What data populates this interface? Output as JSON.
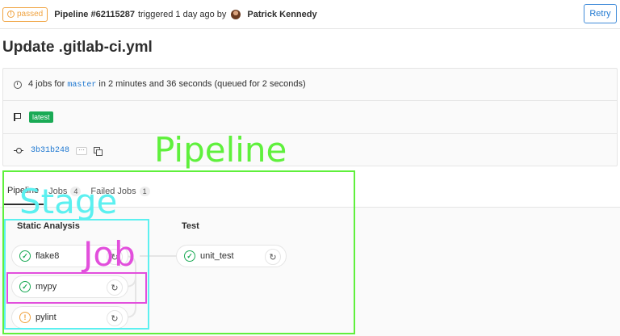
{
  "header": {
    "status_label": "passed",
    "status_icon": "warning-circle-icon",
    "pipeline_title": "Pipeline #62115287",
    "triggered_text": "triggered 1 day ago by",
    "author": "Patrick Kennedy",
    "retry_label": "Retry"
  },
  "commit": {
    "title": "Update .gitlab-ci.yml"
  },
  "info": {
    "jobs_prefix": "4 jobs for",
    "branch": "master",
    "jobs_suffix": "in 2 minutes and 36 seconds (queued for 2 seconds)",
    "badge": "latest",
    "sha": "3b31b248",
    "ellipsis": "···"
  },
  "tabs": [
    {
      "label": "Pipeline",
      "count": null,
      "active": true
    },
    {
      "label": "Jobs",
      "count": "4"
    },
    {
      "label": "Failed Jobs",
      "count": "1"
    }
  ],
  "stages": [
    {
      "name": "Static Analysis",
      "jobs": [
        {
          "name": "flake8",
          "status": "success",
          "status_glyph": "✓",
          "action_glyph": "↻"
        },
        {
          "name": "mypy",
          "status": "success",
          "status_glyph": "✓",
          "action_glyph": "↻"
        },
        {
          "name": "pylint",
          "status": "warning",
          "status_glyph": "!",
          "action_glyph": "↻"
        }
      ]
    },
    {
      "name": "Test",
      "jobs": [
        {
          "name": "unit_test",
          "status": "success",
          "status_glyph": "✓",
          "action_glyph": "↻"
        }
      ]
    }
  ],
  "annotations": {
    "pipeline": {
      "label": "Pipeline",
      "color": "#5ff03c"
    },
    "stage": {
      "label": "Stage",
      "color": "#5cf0f0"
    },
    "job": {
      "label": "Job",
      "color": "#e24fdc"
    }
  },
  "colors": {
    "success": "#1aaa55",
    "warning": "#f0a340",
    "link": "#1f78d1"
  }
}
